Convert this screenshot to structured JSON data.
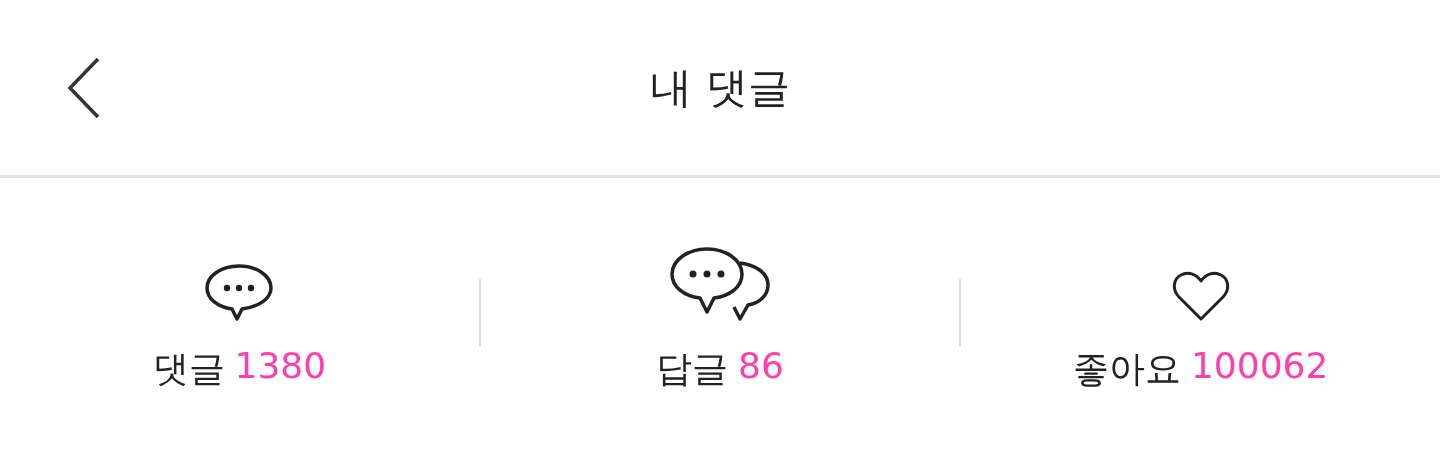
{
  "header": {
    "title": "내 댓글"
  },
  "stats": [
    {
      "kind": "comment",
      "label": "댓글",
      "count": "1380"
    },
    {
      "kind": "reply",
      "label": "답글",
      "count": "86"
    },
    {
      "kind": "like",
      "label": "좋아요",
      "count": "100062"
    }
  ]
}
